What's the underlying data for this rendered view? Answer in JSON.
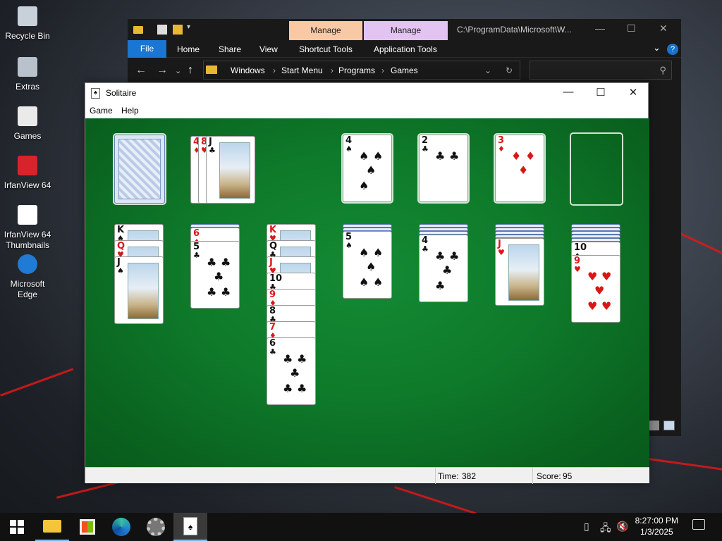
{
  "desktop": {
    "icons": [
      {
        "label": "Recycle Bin",
        "icon": "recycle-bin-icon"
      },
      {
        "label": "Extras",
        "icon": "folder-icon"
      },
      {
        "label": "Games",
        "icon": "gamepad-icon"
      },
      {
        "label": "IrfanView 64",
        "icon": "irfanview-icon"
      },
      {
        "label": "IrfanView 64 Thumbnails",
        "icon": "irfanview-thumbnails-icon"
      },
      {
        "label": "Microsoft Edge",
        "icon": "edge-icon"
      }
    ]
  },
  "explorer": {
    "manage_tabs": [
      "Manage",
      "Manage"
    ],
    "path_title": "C:\\ProgramData\\Microsoft\\W...",
    "ribbon_tabs": {
      "file": "File",
      "home": "Home",
      "share": "Share",
      "view": "View",
      "shortcut_tools": "Shortcut Tools",
      "application_tools": "Application Tools"
    },
    "breadcrumb": [
      "Windows",
      "Start Menu",
      "Programs",
      "Games"
    ],
    "manage_colors": [
      "#f9c9a6",
      "#e3c3f2"
    ]
  },
  "solitaire": {
    "title": "Solitaire",
    "menu": {
      "game": "Game",
      "help": "Help"
    },
    "status": {
      "time_label": "Time:",
      "time": "382",
      "score_label": "Score:",
      "score": "95"
    },
    "felt_color": "#0e7a2a",
    "waste": [
      {
        "rank": "4",
        "suit": "♦"
      },
      {
        "rank": "8",
        "suit": "♥"
      },
      {
        "rank": "J",
        "suit": "♣"
      }
    ],
    "foundations": [
      {
        "rank": "4",
        "suit": "♠"
      },
      {
        "rank": "2",
        "suit": "♣"
      },
      {
        "rank": "3",
        "suit": "♦"
      },
      {
        "rank": "",
        "suit": ""
      }
    ],
    "tableau": [
      {
        "hidden": 0,
        "cards": [
          {
            "rank": "K",
            "suit": "♠"
          },
          {
            "rank": "Q",
            "suit": "♥"
          },
          {
            "rank": "J",
            "suit": "♠"
          }
        ]
      },
      {
        "hidden": 1,
        "cards": [
          {
            "rank": "6",
            "suit": "♦"
          },
          {
            "rank": "5",
            "suit": "♣"
          }
        ]
      },
      {
        "hidden": 0,
        "cards": [
          {
            "rank": "K",
            "suit": "♥"
          },
          {
            "rank": "Q",
            "suit": "♣"
          },
          {
            "rank": "J",
            "suit": "♥"
          },
          {
            "rank": "10",
            "suit": "♣"
          },
          {
            "rank": "9",
            "suit": "♦"
          },
          {
            "rank": "8",
            "suit": "♣"
          },
          {
            "rank": "7",
            "suit": "♦"
          },
          {
            "rank": "6",
            "suit": "♣"
          }
        ]
      },
      {
        "hidden": 2,
        "cards": [
          {
            "rank": "5",
            "suit": "♠"
          }
        ]
      },
      {
        "hidden": 3,
        "cards": [
          {
            "rank": "4",
            "suit": "♣"
          }
        ]
      },
      {
        "hidden": 4,
        "cards": [
          {
            "rank": "J",
            "suit": "♥"
          }
        ]
      },
      {
        "hidden": 5,
        "cards": [
          {
            "rank": "10",
            "suit": "♠"
          },
          {
            "rank": "9",
            "suit": "♥"
          }
        ]
      }
    ]
  },
  "taskbar": {
    "apps": [
      "windows-start-icon",
      "file-explorer-icon",
      "store-icon",
      "edge-icon",
      "settings-gear-icon",
      "solitaire-icon"
    ],
    "tray": [
      "usb-icon",
      "network-icon",
      "volume-muted-icon"
    ],
    "time": "8:27:00 PM",
    "date": "1/3/2025"
  }
}
